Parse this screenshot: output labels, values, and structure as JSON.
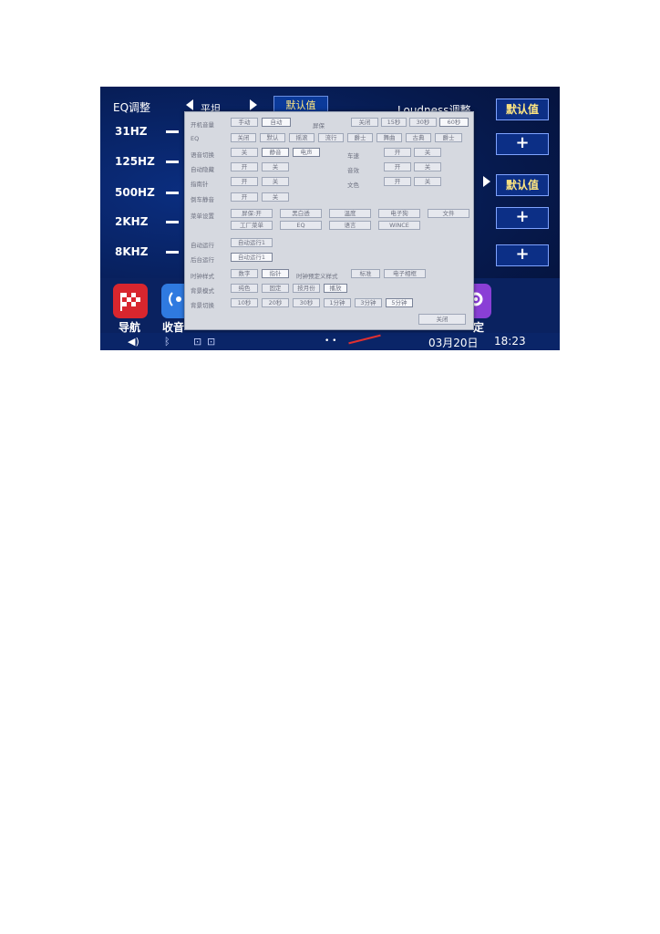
{
  "eq": {
    "title": "EQ调整",
    "preset_label": "平坦",
    "default_label": "默认值",
    "bands": [
      "31HZ",
      "125HZ",
      "500HZ",
      "2KHZ",
      "8KHZ"
    ]
  },
  "loudness": {
    "title": "Loudness调整",
    "default_label_1": "默认值",
    "default_label_2": "默认值",
    "plus_label": "+"
  },
  "dialog": {
    "rows": {
      "boot_volume": {
        "label": "开机音量",
        "options": [
          "手动",
          "自动"
        ]
      },
      "screen_saver": {
        "label": "屏保",
        "options": [
          "关闭",
          "15秒",
          "30秒",
          "60秒"
        ]
      },
      "eq": {
        "label": "EQ",
        "options": [
          "关闭",
          "默认",
          "摇滚",
          "流行",
          "爵士",
          "舞曲",
          "古典",
          "爵士"
        ]
      },
      "voice_switch": {
        "label": "语音切换",
        "options": [
          "关",
          "静音",
          "电声"
        ]
      },
      "car_speed": {
        "label": "车速",
        "options": [
          "开",
          "关"
        ]
      },
      "auto_hide": {
        "label": "自动隐藏",
        "options": [
          "开",
          "关"
        ]
      },
      "sound": {
        "label": "音效",
        "options": [
          "开",
          "关"
        ]
      },
      "compass": {
        "label": "指南针",
        "options": [
          "开",
          "关"
        ]
      },
      "text_color": {
        "label": "文色",
        "options": [
          "开",
          "关"
        ]
      },
      "reverse_mute": {
        "label": "倒车静音",
        "options": [
          "开",
          "关"
        ]
      },
      "menu_settings": {
        "label": "菜单设置",
        "options_row1": [
          "屏保:开",
          "黑白透",
          "温度",
          "电子狗",
          "文件"
        ],
        "options_row2": [
          "工厂菜单",
          "EQ",
          "语言",
          "WINCE"
        ]
      },
      "auto_run": {
        "label": "自动运行",
        "button": "自动运行1"
      },
      "bg_run": {
        "label": "后台运行",
        "button": "自动运行1"
      },
      "clock_style": {
        "label": "时钟样式",
        "options": [
          "数字",
          "指针"
        ],
        "label2": "时钟预定义样式",
        "options2": [
          "标准",
          "电子相框"
        ]
      },
      "wallpaper_mode": {
        "label": "背景模式",
        "options": [
          "纯色",
          "固定",
          "按月份",
          "播放"
        ]
      },
      "wallpaper_switch": {
        "label": "背景切换",
        "options": [
          "10秒",
          "20秒",
          "30秒",
          "1分钟",
          "3分钟",
          "5分钟"
        ]
      },
      "close": "关闭"
    }
  },
  "dock": {
    "nav_label": "导航",
    "radio_label": "收音",
    "settings_label": "定"
  },
  "status": {
    "date": "03月20日",
    "time": "18:23"
  },
  "colors": {
    "background": "#061a4e",
    "button_text": "#ffe680",
    "dialog_bg": "#d6d9e0"
  }
}
